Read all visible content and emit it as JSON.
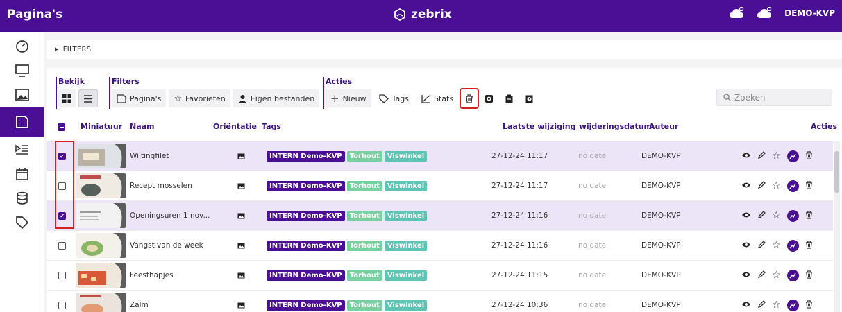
{
  "header": {
    "page_title": "Pagina's",
    "brand": "zebrix",
    "user": "DEMO-KVP"
  },
  "filters_bar": {
    "label": "FILTERS"
  },
  "toolbar": {
    "bekijk_label": "Bekijk",
    "filters_label": "Filters",
    "acties_label": "Acties",
    "filter_paginas": "Pagina's",
    "filter_favorieten": "Favorieten",
    "filter_eigen": "Eigen bestanden",
    "nieuw": "Nieuw",
    "tags": "Tags",
    "stats": "Stats"
  },
  "search": {
    "placeholder": "Zoeken"
  },
  "columns": {
    "miniatuur": "Miniatuur",
    "naam": "Naam",
    "orientatie": "Oriëntatie",
    "tags": "Tags",
    "laatste_wijziging": "Laatste wijziging",
    "auto_verwijdering": "Auto. verwijderingsdatum",
    "auteur": "Auteur",
    "acties": "Acties"
  },
  "rows": [
    {
      "checked": true,
      "name": "Wijtingfilet",
      "tags": [
        "INTERN Demo-KVP",
        "Torhout",
        "Viswinkel"
      ],
      "modified": "27-12-24 11:17",
      "auto_delete": "no date",
      "author": "DEMO-KVP"
    },
    {
      "checked": false,
      "name": "Recept mosselen",
      "tags": [
        "INTERN Demo-KVP",
        "Torhout",
        "Viswinkel"
      ],
      "modified": "27-12-24 11:17",
      "auto_delete": "no date",
      "author": "DEMO-KVP"
    },
    {
      "checked": true,
      "name": "Openingsuren 1 nov...",
      "tags": [
        "INTERN Demo-KVP",
        "Torhout",
        "Viswinkel"
      ],
      "modified": "27-12-24 11:16",
      "auto_delete": "no date",
      "author": "DEMO-KVP"
    },
    {
      "checked": false,
      "name": "Vangst van de week",
      "tags": [
        "INTERN Demo-KVP",
        "Torhout",
        "Viswinkel"
      ],
      "modified": "27-12-24 11:16",
      "auto_delete": "no date",
      "author": "DEMO-KVP"
    },
    {
      "checked": false,
      "name": "Feesthapjes",
      "tags": [
        "INTERN Demo-KVP",
        "Torhout",
        "Viswinkel"
      ],
      "modified": "27-12-24 11:15",
      "auto_delete": "no date",
      "author": "DEMO-KVP"
    },
    {
      "checked": false,
      "name": "Zalm",
      "tags": [
        "INTERN Demo-KVP",
        "Torhout",
        "Viswinkel"
      ],
      "modified": "27-12-24 10:36",
      "auto_delete": "no date",
      "author": "DEMO-KVP"
    }
  ],
  "colors": {
    "brand": "#4b0f96",
    "selected_row": "#ece4f7",
    "highlight": "#d32121",
    "tag_green": "#78d0a0",
    "tag_teal": "#5ec5b5"
  },
  "icons": {
    "sidebar": [
      "dashboard-icon",
      "monitor-icon",
      "image-icon",
      "pages-icon",
      "playlist-icon",
      "calendar-icon",
      "database-icon",
      "tag-icon"
    ],
    "row_actions": [
      "eye-icon",
      "pencil-icon",
      "star-icon",
      "stats-icon",
      "trash-icon"
    ]
  }
}
